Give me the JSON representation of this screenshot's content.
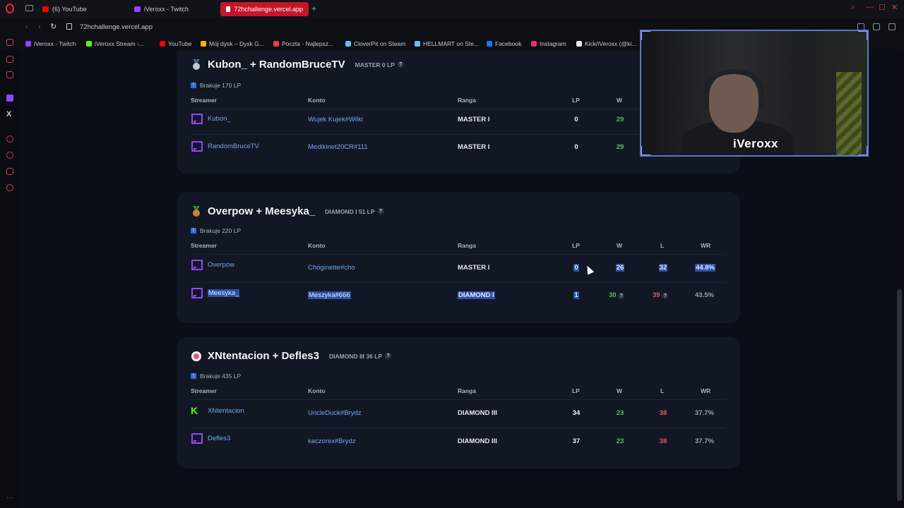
{
  "browser": {
    "tabs": [
      {
        "label": "(6) YouTube",
        "icon": "youtube-icon"
      },
      {
        "label": "iVeroxx - Twitch",
        "icon": "twitch-icon"
      },
      {
        "label": "72hchallenge.vercel.app",
        "icon": "vercel-icon"
      }
    ],
    "url": "72hchallenge.vercel.app",
    "bookmarks": [
      {
        "label": "iVeroxx - Twitch",
        "color": "#9146ff"
      },
      {
        "label": "iVeroxx Stream -...",
        "color": "#53fc18"
      },
      {
        "label": "YouTube",
        "color": "#ff0000"
      },
      {
        "label": "Mój dysk – Dysk G...",
        "color": "#f4b400"
      },
      {
        "label": "Poczta - Najlepsz...",
        "color": "#ff3d3d"
      },
      {
        "label": "CloverPit on Steam",
        "color": "#66c0f4"
      },
      {
        "label": "HELLMART on Ste...",
        "color": "#66c0f4"
      },
      {
        "label": "Facebook",
        "color": "#1877f2"
      },
      {
        "label": "Instagram",
        "color": "#e1306c"
      },
      {
        "label": "Kick/iVeroxx (@ki...",
        "color": "#e6e8ee"
      }
    ]
  },
  "headers": {
    "streamer": "Streamer",
    "konto": "Konto",
    "ranga": "Ranga",
    "lp": "LP",
    "w": "W",
    "l": "L",
    "wr": "WR"
  },
  "teams": [
    {
      "name": "Kubon_ + RandomBruceTV",
      "rank": "MASTER 0 LP",
      "missing": "Brakuje 170 LP",
      "medal_color": "#c0c6d0",
      "players": [
        {
          "streamer": "Kubon_",
          "account": "Wujek Kujek#Wilki",
          "rank": "MASTER I",
          "lp": "0",
          "w": "29"
        },
        {
          "streamer": "RandomBruceTV",
          "account": "Medikinet20CR#111",
          "rank": "MASTER I",
          "lp": "0",
          "w": "29"
        }
      ]
    },
    {
      "name": "Overpow + Meesyka_",
      "rank": "DIAMOND I 51 LP",
      "missing": "Brakuje 220 LP",
      "medal_color": "#c9823a",
      "players": [
        {
          "streamer": "Overpow",
          "account": "Choginette#cho",
          "rank": "MASTER I",
          "lp": "0",
          "w": "26",
          "l": "32",
          "wr": "44.8%"
        },
        {
          "streamer": "Meesyka_",
          "account": "Meszyka#666",
          "rank": "DIAMOND I",
          "lp": "1",
          "w": "30",
          "l": "39",
          "wr": "43.5%"
        }
      ]
    },
    {
      "name": "XNtentacion + Defles3",
      "rank": "DIAMOND III 36 LP",
      "missing": "Brakuje 435 LP",
      "medal_color": "#e2576a",
      "players": [
        {
          "streamer": "XNtentacion",
          "account": "UncleDuck#Brydz",
          "rank": "DIAMOND III",
          "lp": "34",
          "w": "23",
          "l": "38",
          "wr": "37.7%"
        },
        {
          "streamer": "Defles3",
          "account": "kaczorex#Brydz",
          "rank": "DIAMOND III",
          "lp": "37",
          "w": "23",
          "l": "38",
          "wr": "37.7%"
        }
      ]
    }
  ],
  "webcam": {
    "name": "iVeroxx"
  }
}
